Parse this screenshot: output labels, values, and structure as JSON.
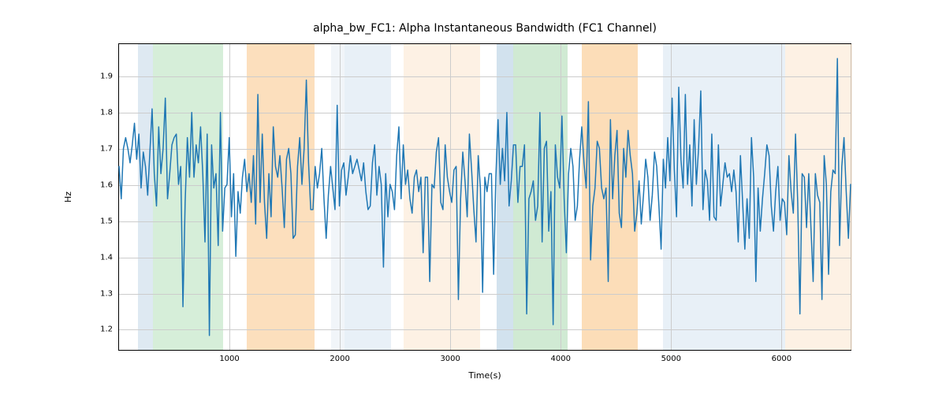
{
  "chart_data": {
    "type": "line",
    "title": "alpha_bw_FC1: Alpha Instantaneous Bandwidth (FC1 Channel)",
    "xlabel": "Time(s)",
    "ylabel": "Hz",
    "xlim": [
      0,
      6640
    ],
    "ylim": [
      1.14,
      1.99
    ],
    "x_ticks": [
      1000,
      2000,
      3000,
      4000,
      5000,
      6000
    ],
    "y_ticks": [
      1.2,
      1.3,
      1.4,
      1.5,
      1.6,
      1.7,
      1.8,
      1.9
    ],
    "grid": true,
    "bands": [
      {
        "x0": 170,
        "x1": 310,
        "color": "#d6e4ef",
        "alpha": 0.8
      },
      {
        "x0": 310,
        "x1": 940,
        "color": "#ccead0",
        "alpha": 0.8
      },
      {
        "x0": 1160,
        "x1": 1770,
        "color": "#fbd7ad",
        "alpha": 0.8
      },
      {
        "x0": 1920,
        "x1": 2040,
        "color": "#edf2f8",
        "alpha": 0.8
      },
      {
        "x0": 2040,
        "x1": 2460,
        "color": "#e2ecf5",
        "alpha": 0.8
      },
      {
        "x0": 2580,
        "x1": 3270,
        "color": "#fdeedd",
        "alpha": 0.8
      },
      {
        "x0": 3420,
        "x1": 3570,
        "color": "#c7dbea",
        "alpha": 0.8
      },
      {
        "x0": 3570,
        "x1": 4060,
        "color": "#c4e5c8",
        "alpha": 0.8
      },
      {
        "x0": 4190,
        "x1": 4700,
        "color": "#fbd4a6",
        "alpha": 0.8
      },
      {
        "x0": 4930,
        "x1": 6030,
        "color": "#e2ecf5",
        "alpha": 0.8
      },
      {
        "x0": 6030,
        "x1": 6640,
        "color": "#fdeedd",
        "alpha": 0.8
      }
    ],
    "line_color": "#1f77b4",
    "x": [
      0,
      20,
      40,
      60,
      80,
      100,
      120,
      140,
      160,
      180,
      200,
      220,
      240,
      260,
      280,
      300,
      320,
      340,
      360,
      380,
      400,
      420,
      440,
      460,
      480,
      500,
      520,
      540,
      560,
      580,
      600,
      620,
      640,
      660,
      680,
      700,
      720,
      740,
      760,
      780,
      800,
      820,
      840,
      860,
      880,
      900,
      920,
      940,
      960,
      980,
      1000,
      1020,
      1040,
      1060,
      1080,
      1100,
      1120,
      1140,
      1160,
      1180,
      1200,
      1220,
      1240,
      1260,
      1280,
      1300,
      1320,
      1340,
      1360,
      1380,
      1400,
      1420,
      1440,
      1460,
      1480,
      1500,
      1520,
      1540,
      1560,
      1580,
      1600,
      1620,
      1640,
      1660,
      1680,
      1700,
      1720,
      1740,
      1760,
      1780,
      1800,
      1820,
      1840,
      1860,
      1880,
      1900,
      1920,
      1940,
      1960,
      1980,
      2000,
      2020,
      2040,
      2060,
      2080,
      2100,
      2120,
      2140,
      2160,
      2180,
      2200,
      2220,
      2240,
      2260,
      2280,
      2300,
      2320,
      2340,
      2360,
      2380,
      2400,
      2420,
      2440,
      2460,
      2480,
      2500,
      2520,
      2540,
      2560,
      2580,
      2600,
      2620,
      2640,
      2660,
      2680,
      2700,
      2720,
      2740,
      2760,
      2780,
      2800,
      2820,
      2840,
      2860,
      2880,
      2900,
      2920,
      2940,
      2960,
      2980,
      3000,
      3020,
      3040,
      3060,
      3080,
      3100,
      3120,
      3140,
      3160,
      3180,
      3200,
      3220,
      3240,
      3260,
      3280,
      3300,
      3320,
      3340,
      3360,
      3380,
      3400,
      3420,
      3440,
      3460,
      3480,
      3500,
      3520,
      3540,
      3560,
      3580,
      3600,
      3620,
      3640,
      3660,
      3680,
      3700,
      3720,
      3740,
      3760,
      3780,
      3800,
      3820,
      3840,
      3860,
      3880,
      3900,
      3920,
      3940,
      3960,
      3980,
      4000,
      4020,
      4040,
      4060,
      4080,
      4100,
      4120,
      4140,
      4160,
      4180,
      4200,
      4220,
      4240,
      4260,
      4280,
      4300,
      4320,
      4340,
      4360,
      4380,
      4400,
      4420,
      4440,
      4460,
      4480,
      4500,
      4520,
      4540,
      4560,
      4580,
      4600,
      4620,
      4640,
      4660,
      4680,
      4700,
      4720,
      4740,
      4760,
      4780,
      4800,
      4820,
      4840,
      4860,
      4880,
      4900,
      4920,
      4940,
      4960,
      4980,
      5000,
      5020,
      5040,
      5060,
      5080,
      5100,
      5120,
      5140,
      5160,
      5180,
      5200,
      5220,
      5240,
      5260,
      5280,
      5300,
      5320,
      5340,
      5360,
      5380,
      5400,
      5420,
      5440,
      5460,
      5480,
      5500,
      5520,
      5540,
      5560,
      5580,
      5600,
      5620,
      5640,
      5660,
      5680,
      5700,
      5720,
      5740,
      5760,
      5780,
      5800,
      5820,
      5840,
      5860,
      5880,
      5900,
      5920,
      5940,
      5960,
      5980,
      6000,
      6020,
      6040,
      6060,
      6080,
      6100,
      6120,
      6140,
      6160,
      6180,
      6200,
      6220,
      6240,
      6260,
      6280,
      6300,
      6320,
      6340,
      6360,
      6380,
      6400,
      6420,
      6440,
      6460,
      6480,
      6500,
      6520,
      6540,
      6560,
      6580,
      6600,
      6620,
      6640
    ],
    "y": [
      1.65,
      1.56,
      1.7,
      1.73,
      1.7,
      1.66,
      1.71,
      1.77,
      1.67,
      1.74,
      1.59,
      1.69,
      1.65,
      1.57,
      1.69,
      1.81,
      1.63,
      1.54,
      1.76,
      1.63,
      1.7,
      1.84,
      1.56,
      1.63,
      1.71,
      1.73,
      1.74,
      1.6,
      1.65,
      1.26,
      1.55,
      1.73,
      1.62,
      1.8,
      1.62,
      1.71,
      1.66,
      1.76,
      1.63,
      1.44,
      1.74,
      1.18,
      1.71,
      1.59,
      1.63,
      1.43,
      1.8,
      1.47,
      1.59,
      1.6,
      1.73,
      1.51,
      1.63,
      1.4,
      1.58,
      1.52,
      1.62,
      1.67,
      1.58,
      1.63,
      1.55,
      1.68,
      1.49,
      1.85,
      1.55,
      1.74,
      1.55,
      1.45,
      1.63,
      1.51,
      1.76,
      1.65,
      1.62,
      1.68,
      1.59,
      1.48,
      1.67,
      1.7,
      1.63,
      1.45,
      1.46,
      1.65,
      1.73,
      1.6,
      1.7,
      1.89,
      1.66,
      1.53,
      1.53,
      1.65,
      1.59,
      1.63,
      1.7,
      1.56,
      1.45,
      1.57,
      1.65,
      1.59,
      1.53,
      1.82,
      1.54,
      1.64,
      1.66,
      1.57,
      1.62,
      1.68,
      1.63,
      1.65,
      1.67,
      1.64,
      1.61,
      1.66,
      1.58,
      1.53,
      1.54,
      1.66,
      1.71,
      1.57,
      1.65,
      1.6,
      1.37,
      1.63,
      1.51,
      1.6,
      1.58,
      1.53,
      1.68,
      1.76,
      1.56,
      1.71,
      1.6,
      1.64,
      1.56,
      1.52,
      1.62,
      1.64,
      1.58,
      1.62,
      1.41,
      1.62,
      1.62,
      1.33,
      1.6,
      1.59,
      1.69,
      1.73,
      1.55,
      1.53,
      1.71,
      1.62,
      1.58,
      1.55,
      1.64,
      1.65,
      1.28,
      1.56,
      1.69,
      1.61,
      1.51,
      1.74,
      1.64,
      1.53,
      1.44,
      1.68,
      1.59,
      1.3,
      1.62,
      1.58,
      1.63,
      1.63,
      1.35,
      1.62,
      1.78,
      1.6,
      1.7,
      1.61,
      1.8,
      1.54,
      1.61,
      1.71,
      1.71,
      1.55,
      1.65,
      1.65,
      1.71,
      1.24,
      1.56,
      1.58,
      1.61,
      1.5,
      1.54,
      1.8,
      1.44,
      1.7,
      1.72,
      1.47,
      1.58,
      1.21,
      1.71,
      1.62,
      1.59,
      1.79,
      1.56,
      1.41,
      1.63,
      1.7,
      1.65,
      1.5,
      1.54,
      1.67,
      1.76,
      1.66,
      1.59,
      1.83,
      1.39,
      1.54,
      1.59,
      1.72,
      1.7,
      1.59,
      1.56,
      1.59,
      1.33,
      1.78,
      1.56,
      1.68,
      1.75,
      1.52,
      1.48,
      1.7,
      1.62,
      1.75,
      1.68,
      1.63,
      1.47,
      1.52,
      1.61,
      1.49,
      1.57,
      1.67,
      1.62,
      1.5,
      1.57,
      1.69,
      1.65,
      1.54,
      1.42,
      1.67,
      1.59,
      1.73,
      1.61,
      1.84,
      1.64,
      1.51,
      1.87,
      1.67,
      1.59,
      1.85,
      1.6,
      1.71,
      1.54,
      1.78,
      1.6,
      1.7,
      1.86,
      1.53,
      1.64,
      1.61,
      1.5,
      1.74,
      1.51,
      1.5,
      1.71,
      1.54,
      1.6,
      1.66,
      1.62,
      1.63,
      1.58,
      1.64,
      1.58,
      1.44,
      1.68,
      1.55,
      1.42,
      1.56,
      1.45,
      1.73,
      1.62,
      1.33,
      1.59,
      1.47,
      1.56,
      1.63,
      1.71,
      1.68,
      1.54,
      1.47,
      1.58,
      1.65,
      1.5,
      1.56,
      1.55,
      1.46,
      1.68,
      1.58,
      1.52,
      1.74,
      1.55,
      1.24,
      1.63,
      1.62,
      1.48,
      1.63,
      1.48,
      1.33,
      1.63,
      1.57,
      1.55,
      1.28,
      1.68,
      1.6,
      1.35,
      1.58,
      1.64,
      1.63,
      1.95,
      1.43,
      1.65,
      1.73,
      1.58,
      1.45,
      1.6
    ]
  }
}
